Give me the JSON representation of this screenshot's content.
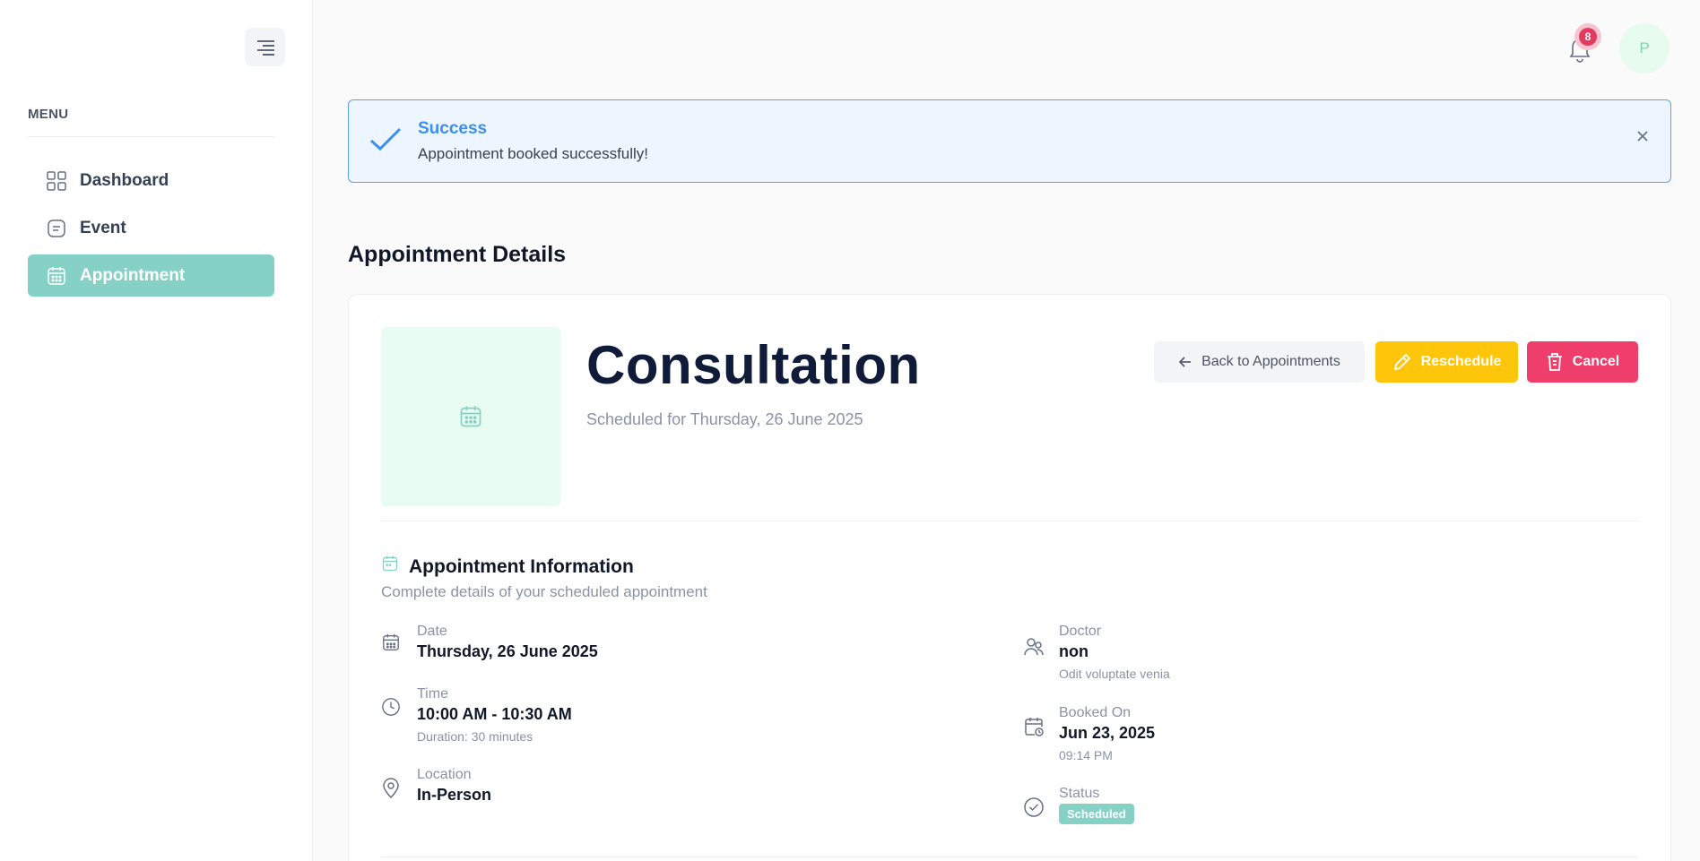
{
  "sidebar": {
    "menu_heading": "MENU",
    "items": [
      {
        "label": "Dashboard",
        "icon": "grid-icon"
      },
      {
        "label": "Event",
        "icon": "note-icon"
      },
      {
        "label": "Appointment",
        "icon": "calendar-icon",
        "active": true
      }
    ]
  },
  "topbar": {
    "notification_count": "8",
    "avatar_initial": "P"
  },
  "alert": {
    "title": "Success",
    "message": "Appointment booked successfully!"
  },
  "page": {
    "title": "Appointment Details"
  },
  "appointment": {
    "title": "Consultation",
    "subtitle": "Scheduled for Thursday, 26 June 2025",
    "buttons": {
      "back": "Back to Appointments",
      "reschedule": "Reschedule",
      "cancel": "Cancel"
    },
    "info_section": {
      "title": "Appointment Information",
      "subtitle": "Complete details of your scheduled appointment"
    },
    "date": {
      "label": "Date",
      "value": "Thursday, 26 June 2025"
    },
    "time": {
      "label": "Time",
      "value": "10:00 AM - 10:30 AM",
      "note": "Duration: 30 minutes"
    },
    "location": {
      "label": "Location",
      "value": "In-Person"
    },
    "doctor": {
      "label": "Doctor",
      "value": "non",
      "note": "Odit voluptate venia"
    },
    "booked_on": {
      "label": "Booked On",
      "value": "Jun 23, 2025",
      "note": "09:14 PM"
    },
    "status": {
      "label": "Status",
      "value": "Scheduled"
    }
  },
  "colors": {
    "accent": "#86d1c6",
    "reschedule": "#fdc60a",
    "cancel": "#ef3e6c",
    "alert_blue": "#3b8ff0"
  }
}
